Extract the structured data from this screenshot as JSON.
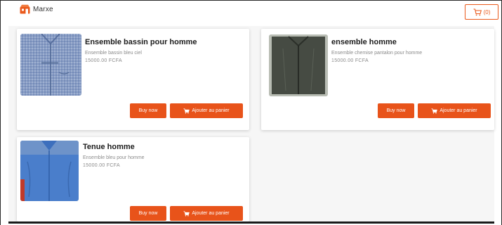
{
  "brand": {
    "name": "Marxe",
    "icon": "store-logo-icon",
    "color": "#ea5a1c"
  },
  "cart": {
    "icon": "cart-icon",
    "count": "(0)"
  },
  "products": [
    {
      "title": "Ensemble bassin pour homme",
      "description": "Ensemble bassin bleu ciel",
      "price": "15000.00 FCFA",
      "buy_label": "Buy now",
      "add_label": "Ajouter au panier"
    },
    {
      "title": "ensemble homme",
      "description": "Ensemble chemise pantalon pour homme",
      "price": "15000.00 FCFA",
      "buy_label": "Buy now",
      "add_label": "Ajouter au panier"
    },
    {
      "title": "Tenue homme",
      "description": "Ensemble bleu pour homme",
      "price": "15000.00 FCFA",
      "buy_label": "Buy now",
      "add_label": "Ajouter au panier"
    }
  ],
  "colors": {
    "accent": "#e8531a",
    "card_bg": "#ffffff",
    "page_bg": "#f6f6f6"
  }
}
